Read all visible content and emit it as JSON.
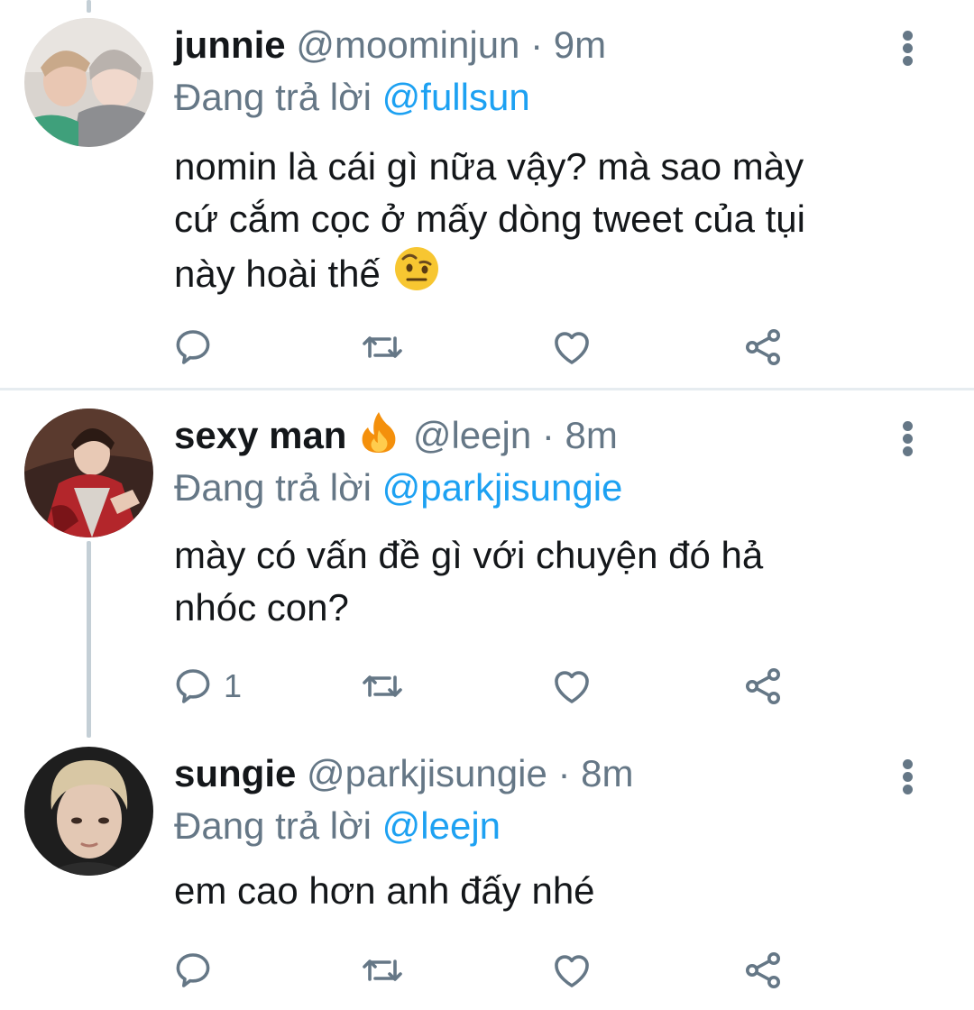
{
  "reply_prefix": "Đang trả lời",
  "tweets": [
    {
      "name": "junnie",
      "handle": "@moominjun",
      "separator": "·",
      "time": "9m",
      "reply_to": "@fullsun",
      "body_lines": [
        "nomin là cái gì nữa vậy? mà sao mày",
        "cứ cắm cọc ở mấy dòng tweet của tụi",
        "này hoài thế"
      ],
      "body_emoji": "face-with-raised-eyebrow-emoji",
      "reply_count": "",
      "retweet_count": "",
      "like_count": ""
    },
    {
      "name": "sexy man",
      "name_emoji": "fire-emoji",
      "handle": "@leejn",
      "separator": "·",
      "time": "8m",
      "reply_to": "@parkjisungie",
      "body_lines": [
        "mày có vấn đề gì với chuyện đó hả",
        "nhóc con?"
      ],
      "reply_count": "1",
      "retweet_count": "",
      "like_count": ""
    },
    {
      "name": "sungie",
      "handle": "@parkjisungie",
      "separator": "·",
      "time": "8m",
      "reply_to": "@leejn",
      "body_lines": [
        "em cao hơn anh đấy nhé"
      ],
      "reply_count": "",
      "retweet_count": "",
      "like_count": ""
    }
  ],
  "colors": {
    "text": "#14171a",
    "secondary": "#657786",
    "mention": "#1da1f2",
    "thread_line": "#c4cfd6",
    "divider": "#e6ecf0"
  },
  "icons": [
    "reply-icon",
    "retweet-icon",
    "like-icon",
    "share-icon",
    "more-options-icon"
  ]
}
